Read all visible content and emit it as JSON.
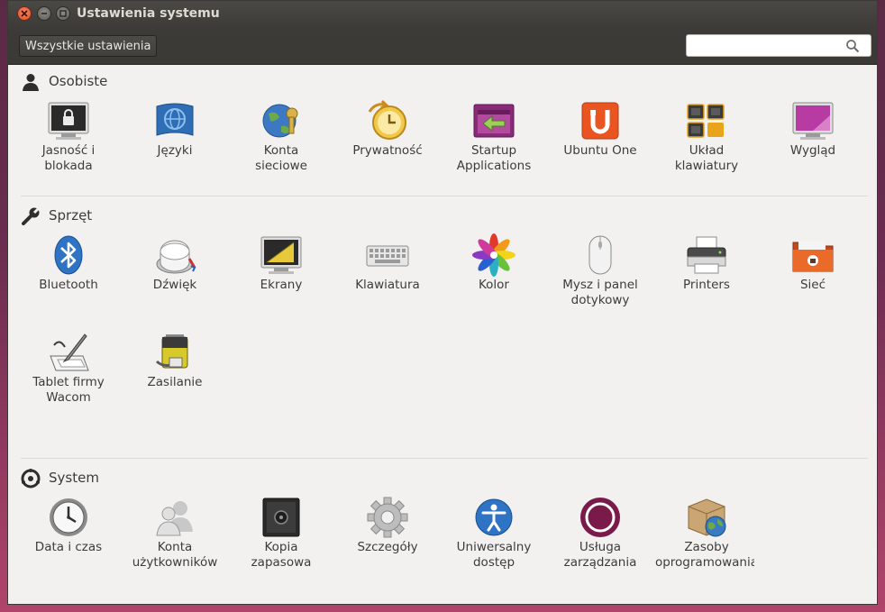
{
  "window": {
    "title": "Ustawienia systemu"
  },
  "toolbar": {
    "all_settings_label": "Wszystkie ustawienia",
    "search_value": ""
  },
  "sections": {
    "personal": {
      "title": "Osobiste",
      "items": [
        {
          "label": "Jasność i\nblokada",
          "icon": "brightness-lock-icon"
        },
        {
          "label": "Języki",
          "icon": "languages-icon"
        },
        {
          "label": "Konta\nsieciowe",
          "icon": "online-accounts-icon"
        },
        {
          "label": "Prywatność",
          "icon": "privacy-icon"
        },
        {
          "label": "Startup\nApplications",
          "icon": "startup-applications-icon"
        },
        {
          "label": "Ubuntu One",
          "icon": "ubuntu-one-icon"
        },
        {
          "label": "Układ\nklawiatury",
          "icon": "keyboard-layout-icon"
        },
        {
          "label": "Wygląd",
          "icon": "appearance-icon"
        }
      ]
    },
    "hardware": {
      "title": "Sprzęt",
      "items": [
        {
          "label": "Bluetooth",
          "icon": "bluetooth-icon"
        },
        {
          "label": "Dźwięk",
          "icon": "sound-icon"
        },
        {
          "label": "Ekrany",
          "icon": "displays-icon"
        },
        {
          "label": "Klawiatura",
          "icon": "keyboard-icon"
        },
        {
          "label": "Kolor",
          "icon": "color-icon"
        },
        {
          "label": "Mysz i panel\ndotykowy",
          "icon": "mouse-icon"
        },
        {
          "label": "Printers",
          "icon": "printer-icon"
        },
        {
          "label": "Sieć",
          "icon": "network-icon"
        },
        {
          "label": "Tablet firmy\nWacom",
          "icon": "wacom-tablet-icon"
        },
        {
          "label": "Zasilanie",
          "icon": "power-icon"
        }
      ]
    },
    "system": {
      "title": "System",
      "items": [
        {
          "label": "Data i czas",
          "icon": "clock-icon"
        },
        {
          "label": "Konta\nużytkowników",
          "icon": "user-accounts-icon"
        },
        {
          "label": "Kopia\nzapasowa",
          "icon": "backup-safe-icon"
        },
        {
          "label": "Szczegóły",
          "icon": "details-gear-icon"
        },
        {
          "label": "Uniwersalny\ndostęp",
          "icon": "universal-access-icon"
        },
        {
          "label": "Usługa\nzarządzania",
          "icon": "landscape-management-icon"
        },
        {
          "label": "Zasoby\noprogramowania",
          "icon": "software-sources-icon"
        }
      ]
    }
  }
}
